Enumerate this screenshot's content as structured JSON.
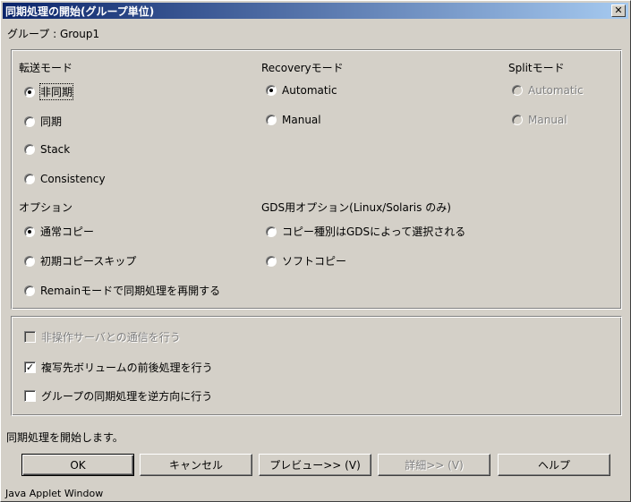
{
  "window": {
    "title": "同期処理の開始(グループ単位)",
    "close_label": "✕"
  },
  "group_line": "グループ : Group1",
  "transfer_mode": {
    "label": "転送モード",
    "options": [
      "非同期",
      "同期",
      "Stack",
      "Consistency"
    ],
    "selected": "非同期"
  },
  "recovery_mode": {
    "label": "Recoveryモード",
    "options": [
      "Automatic",
      "Manual"
    ],
    "selected": "Automatic"
  },
  "split_mode": {
    "label": "Splitモード",
    "options": [
      "Automatic",
      "Manual"
    ],
    "disabled": true
  },
  "options": {
    "label": "オプション",
    "items": [
      "通常コピー",
      "初期コピースキップ",
      "Remainモードで同期処理を再開する"
    ],
    "selected": "通常コピー"
  },
  "gds_options": {
    "label": "GDS用オプション(Linux/Solaris のみ)",
    "items": [
      "コピー種別はGDSによって選択される",
      "ソフトコピー"
    ]
  },
  "checkboxes": [
    {
      "label": "非操作サーバとの通信を行う",
      "checked": false,
      "disabled": true
    },
    {
      "label": "複写先ボリュームの前後処理を行う",
      "checked": true,
      "disabled": false
    },
    {
      "label": "グループの同期処理を逆方向に行う",
      "checked": false,
      "disabled": false
    }
  ],
  "status_text": "同期処理を開始します。",
  "buttons": {
    "ok": "OK",
    "cancel": "キャンセル",
    "preview": "プレビュー>> (V)",
    "details": "詳細>> (V)",
    "help": "ヘルプ"
  },
  "footer": "Java Applet Window"
}
